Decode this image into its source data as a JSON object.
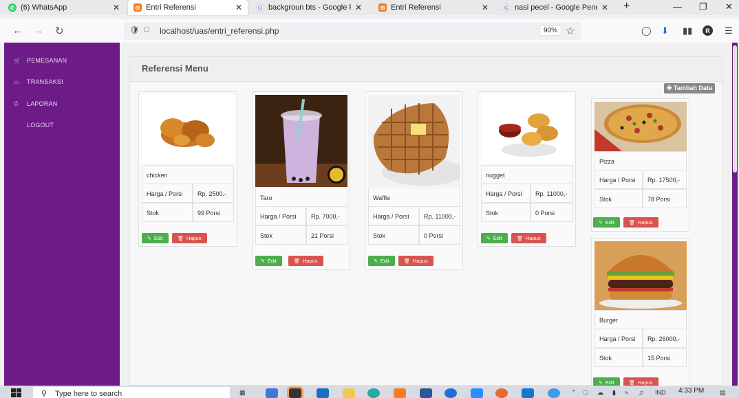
{
  "tabs": [
    {
      "title": "(6) WhatsApp",
      "icon": "whatsapp-icon",
      "color": "#25d366"
    },
    {
      "title": "Entri Referensi",
      "icon": "xampp-icon",
      "color": "#f57c20"
    },
    {
      "title": "backgroun bts - Google Pene",
      "icon": "google-icon",
      "color": "#4285f4"
    },
    {
      "title": "Entri Referensi",
      "icon": "xampp-icon",
      "color": "#f57c20"
    },
    {
      "title": "nasi pecel - Google Penelusur",
      "icon": "google-icon",
      "color": "#4285f4"
    }
  ],
  "browser": {
    "url": "localhost/uas/entri_referensi.php",
    "zoom": "90%",
    "profile_initial": "R"
  },
  "sidebar": {
    "items": [
      {
        "label": "PEMESANAN",
        "icon": "cart-icon"
      },
      {
        "label": "TRANSAKSI",
        "icon": "laptop-icon"
      },
      {
        "label": "LAPORAN",
        "icon": "print-icon"
      },
      {
        "label": "LOGOUT",
        "icon": ""
      }
    ]
  },
  "panel": {
    "title": "Referensi Menu",
    "add_label": "✚ Tambah Data"
  },
  "labels": {
    "harga": "Harga / Porsi",
    "stok": "Stok",
    "edit": "Edit",
    "hapus": "Hapus"
  },
  "menu": [
    {
      "name": "chicken",
      "harga": "Rp. 2500,-",
      "stok": "99 Porsi"
    },
    {
      "name": "Taro",
      "harga": "Rp. 7000,-",
      "stok": "21 Porsi"
    },
    {
      "name": "Waffle",
      "harga": "Rp. 11000,-",
      "stok": "0 Porsi"
    },
    {
      "name": "nugget",
      "harga": "Rp. 11000,-",
      "stok": "0 Porsi"
    },
    {
      "name": "Pizza",
      "harga": "Rp. 17500,-",
      "stok": "78 Porsi"
    },
    {
      "name": "Burger",
      "harga": "Rp. 26000,-",
      "stok": "15 Porsi"
    }
  ],
  "taskbar": {
    "search_placeholder": "Type here to search",
    "time": "4:33 PM",
    "lang": "IND"
  },
  "colors": {
    "sidebar": "#6d1b86",
    "edit": "#4cae4c",
    "hapus": "#d9534f"
  }
}
